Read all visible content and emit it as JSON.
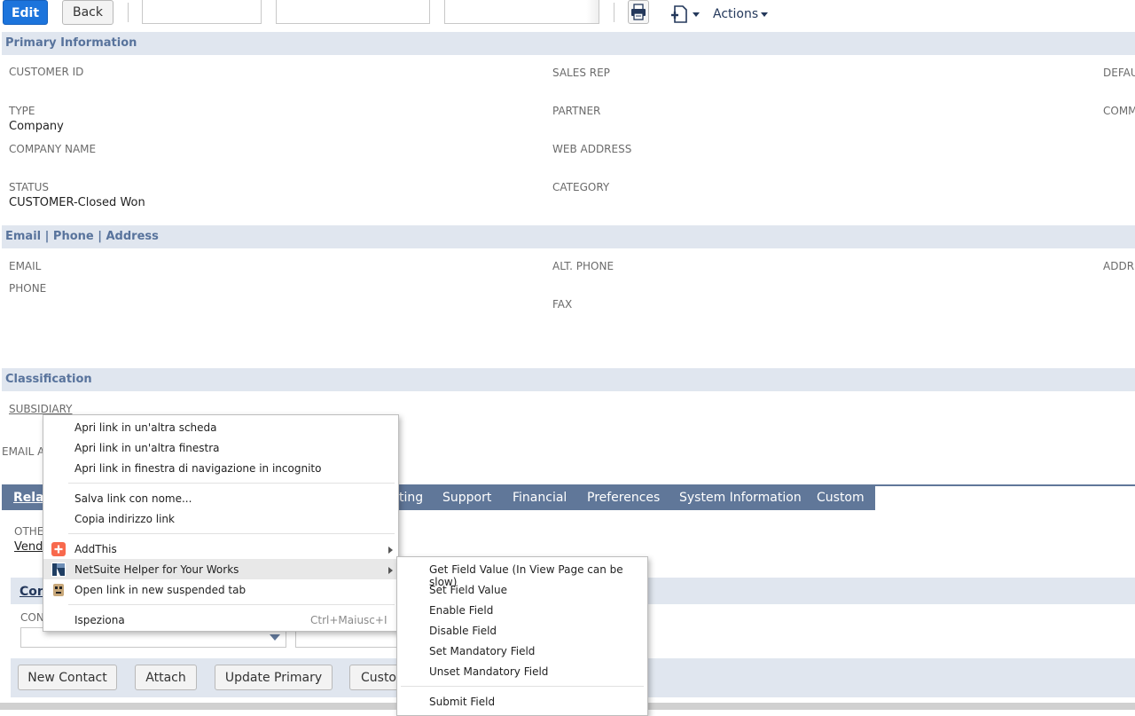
{
  "toolbar": {
    "edit": "Edit",
    "back": "Back",
    "actions": "Actions",
    "print_icon": "printer-icon",
    "new_icon": "new-document-icon"
  },
  "primary": {
    "header": "Primary Information",
    "customer_id_label": "CUSTOMER ID",
    "type_label": "TYPE",
    "type_value": "Company",
    "company_name_label": "COMPANY NAME",
    "status_label": "STATUS",
    "status_value": "CUSTOMER-Closed Won",
    "sales_rep_label": "SALES REP",
    "partner_label": "PARTNER",
    "web_address_label": "WEB ADDRESS",
    "category_label": "CATEGORY",
    "default_label": "DEFAU",
    "comm_label": "COMM"
  },
  "contact_section": {
    "header": "Email | Phone | Address",
    "email_label": "EMAIL",
    "phone_label": "PHONE",
    "alt_phone_label": "ALT. PHONE",
    "fax_label": "FAX",
    "address_label": "ADDRE"
  },
  "classification": {
    "header": "Classification",
    "subsidiary_label": "SUBSIDIARY",
    "email_a_label": "EMAIL A"
  },
  "subtabs": {
    "relationships": "Rela",
    "marketing": "ting",
    "support": "Support",
    "financial": "Financial",
    "preferences": "Preferences",
    "system_information": "System Information",
    "custom": "Custom"
  },
  "relationships": {
    "other_label": "OTHE",
    "vendor_link": "Vend",
    "contacts_header": "Con",
    "con_label": "CON"
  },
  "buttons": {
    "new_contact": "New Contact",
    "attach": "Attach",
    "update_primary": "Update Primary",
    "custo": "Custo"
  },
  "context_menu": {
    "items": [
      "Apri link in un'altra scheda",
      "Apri link in un'altra finestra",
      "Apri link in finestra di navigazione in incognito",
      "Salva link con nome...",
      "Copia indirizzo link",
      "AddThis",
      "NetSuite Helper for Your Works",
      "Open link in new suspended tab",
      "Ispeziona"
    ],
    "inspect_shortcut": "Ctrl+Maiusc+I"
  },
  "submenu": {
    "items": [
      "Get Field Value (In View Page can be slow)",
      "Set Field Value",
      "Enable Field",
      "Disable Field",
      "Set Mandatory Field",
      "Unset Mandatory Field",
      "Submit Field"
    ]
  },
  "colors": {
    "primary_button": "#1c74dc",
    "section_header_bg": "#e0e6ef",
    "section_header_text": "#58739c",
    "subtab_bar": "#607799"
  }
}
